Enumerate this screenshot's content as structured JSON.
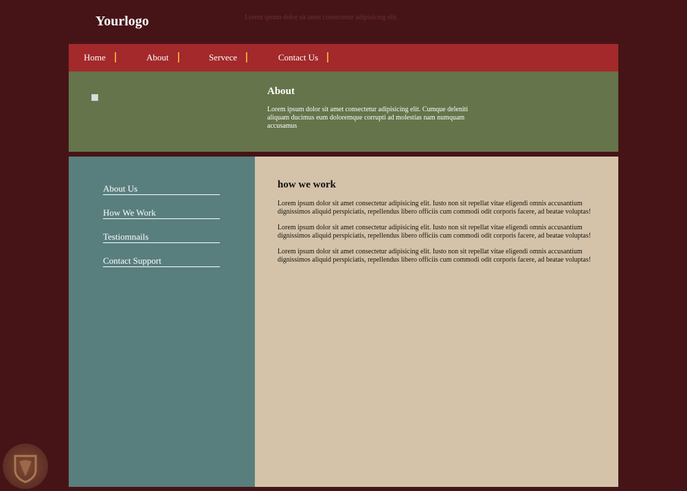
{
  "header": {
    "logo": "Yourlogo",
    "tagline": "Lorem ipsum dolor sit amet consectetur adipisicing elit."
  },
  "nav": {
    "items": [
      {
        "label": "Home"
      },
      {
        "label": "About"
      },
      {
        "label": "Servece"
      },
      {
        "label": "Contact Us"
      }
    ]
  },
  "banner": {
    "title": "About",
    "text": "Lorem ipsum dolor sit amet consectetur adipisicing elit. Cumque deleniti aliquam ducimus eum doloremque corrupti ad molestias nam numquam accusamus"
  },
  "sidebar": {
    "links": [
      {
        "label": "About Us"
      },
      {
        "label": "How We Work"
      },
      {
        "label": "Testiomnails"
      },
      {
        "label": "Contact Support"
      }
    ]
  },
  "content": {
    "title": "how we work",
    "paragraphs": [
      "Lorem ipsum dolor sit amet consectetur adipisicing elit. Iusto non sit repellat vitae eligendi omnis accusantium dignissimos aliquid perspiciatis, repellendus libero officiis cum commodi odit corporis facere, ad beatae voluptas!",
      "Lorem ipsum dolor sit amet consectetur adipisicing elit. Iusto non sit repellat vitae eligendi omnis accusantium dignissimos aliquid perspiciatis, repellendus libero officiis cum commodi odit corporis facere, ad beatae voluptas!",
      "Lorem ipsum dolor sit amet consectetur adipisicing elit. Iusto non sit repellat vitae eligendi omnis accusantium dignissimos aliquid perspiciatis, repellendus libero officiis cum commodi odit corporis facere, ad beatae voluptas!"
    ]
  },
  "colors": {
    "page_background": "#461417",
    "nav_background": "#a3292b",
    "nav_separator": "#e8a33a",
    "banner_background": "#65744a",
    "sidebar_background": "#587f7d",
    "content_background": "#d4c3a9"
  },
  "icons": {
    "banner_image": "broken-image-icon",
    "watermark": "shield-watermark-logo"
  }
}
